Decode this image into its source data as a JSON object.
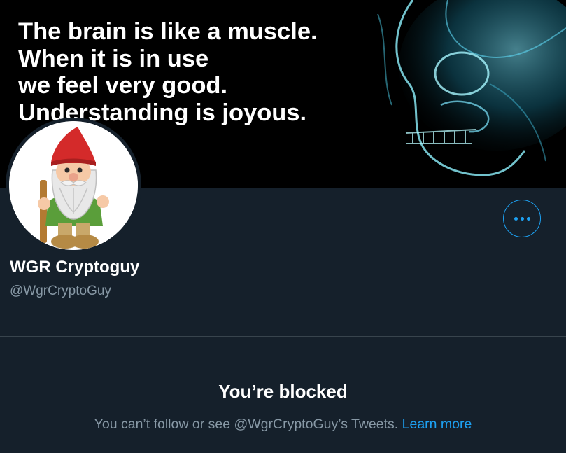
{
  "banner": {
    "quote_lines": [
      "The brain is like a muscle.",
      "When it is in use",
      "we feel very good.",
      "Understanding is joyous."
    ]
  },
  "profile": {
    "display_name": "WGR Cryptoguy",
    "handle": "@WgrCryptoGuy"
  },
  "actions": {
    "more_icon": "more-horizontal-icon"
  },
  "blocked": {
    "title": "You’re blocked",
    "message": "You can’t follow or see @WgrCryptoGuy’s Tweets.",
    "link": "Learn more"
  },
  "colors": {
    "background": "#15202b",
    "accent": "#1da1f2",
    "secondary_text": "#8899a6"
  }
}
